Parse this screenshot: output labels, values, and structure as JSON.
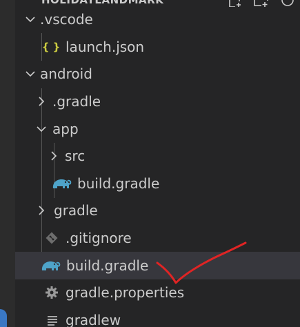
{
  "header": {
    "title": "HOLIDAYLANDMARK"
  },
  "tree": {
    "vscode_folder": {
      "label": ".vscode",
      "icon": "chevron-down-icon"
    },
    "launch_json": {
      "label": "launch.json",
      "icon_glyph": "{ }",
      "icon": "json-braces-icon"
    },
    "android_folder": {
      "label": "android",
      "icon": "chevron-down-icon"
    },
    "gradle_hidden_folder": {
      "label": ".gradle",
      "icon": "chevron-right-icon"
    },
    "app_folder": {
      "label": "app",
      "icon": "chevron-down-icon"
    },
    "src_folder": {
      "label": "src",
      "icon": "chevron-right-icon"
    },
    "app_build_gradle": {
      "label": "build.gradle",
      "icon": "gradle-elephant-icon"
    },
    "gradle_folder": {
      "label": "gradle",
      "icon": "chevron-right-icon"
    },
    "gitignore": {
      "label": ".gitignore",
      "icon": "git-icon"
    },
    "root_build_gradle": {
      "label": "build.gradle",
      "icon": "gradle-elephant-icon"
    },
    "gradle_properties": {
      "label": "gradle.properties",
      "icon": "gear-icon"
    },
    "gradlew": {
      "label": "gradlew",
      "icon": "text-file-icon"
    }
  },
  "colors": {
    "sidebar_bg": "#252526",
    "selected_row_bg": "#37373d",
    "text": "#cccccc",
    "json_icon": "#cbcb41",
    "gradle_icon": "#4ea3c9",
    "annotation_red": "#e02424"
  }
}
